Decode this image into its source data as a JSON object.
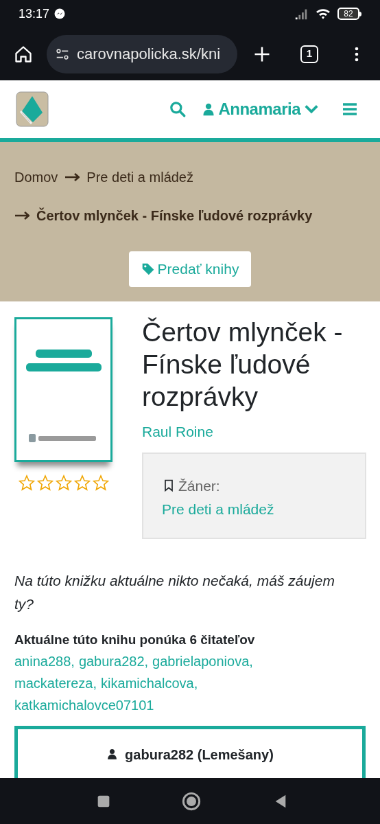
{
  "status_bar": {
    "time": "13:17",
    "battery": "82"
  },
  "browser": {
    "url": "carovnapolicka.sk/kni",
    "tab_count": "1"
  },
  "header": {
    "user": "Annamaria"
  },
  "breadcrumb": [
    {
      "label": "Domov",
      "current": false
    },
    {
      "label": "Pre deti a mládež",
      "current": false
    },
    {
      "label": "Čertov mlynček - Fínske ľudové rozprávky",
      "current": true
    }
  ],
  "sell_button": "Predať knihy",
  "book": {
    "stars": 0,
    "title": "Čertov mlynček - Fínske ľudové rozprávky",
    "author": "Raul Roine",
    "genre_label": "Žáner:",
    "genre": "Pre deti a mládež"
  },
  "waiting_note": "Na túto knižku aktuálne nikto nečaká, máš záujem ty?",
  "offers": {
    "heading": "Aktuálne túto knihu ponúka 6 čitateľov",
    "users": [
      "anina288,",
      "gabura282,",
      "gabrielaponiova,",
      "mackatereza,",
      "kikamichalcova,",
      "katkamichalovce07101"
    ]
  },
  "seller_card": {
    "name": "gabura282 (Lemešany)"
  }
}
